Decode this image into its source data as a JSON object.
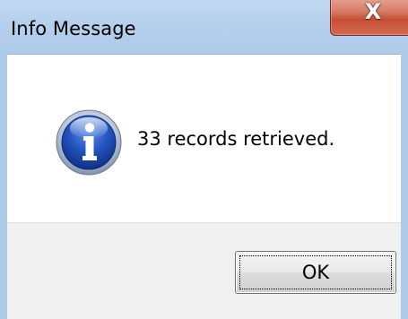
{
  "window": {
    "title": "Info Message",
    "close_glyph": "X",
    "close_icon": "close-icon"
  },
  "message": {
    "icon": "info-icon",
    "text": "33 records retrieved."
  },
  "buttons": {
    "ok_label": "OK"
  },
  "colors": {
    "titlebar": "#b7d0ec",
    "close_button": "#c54f36",
    "footer": "#f0f0f0",
    "info_icon": "#1f4fb6"
  }
}
